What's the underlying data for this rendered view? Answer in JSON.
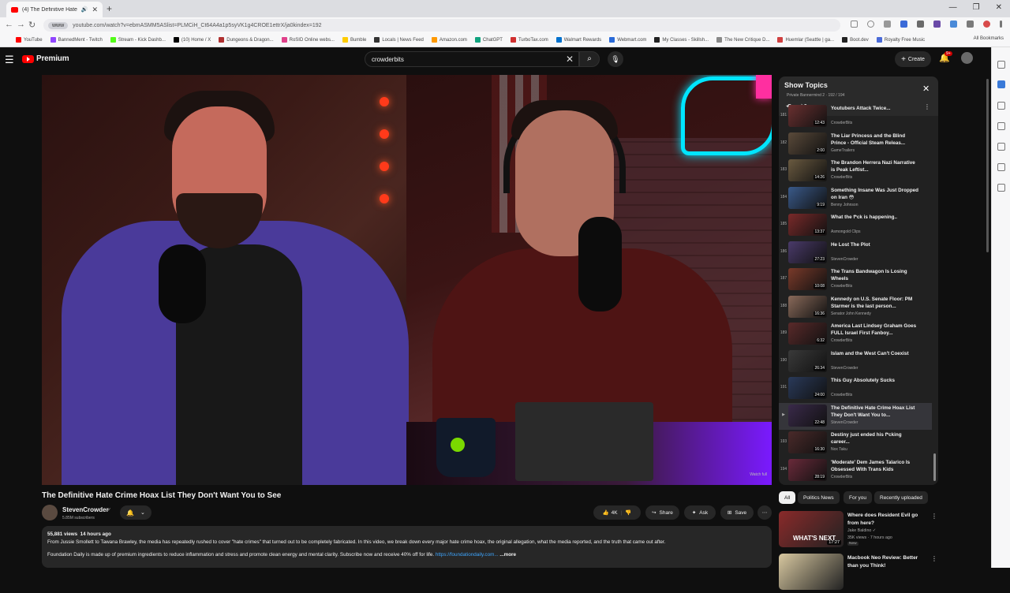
{
  "browser": {
    "tab_title": "(4) The Definitive Hate Cr",
    "url": "youtube.com/watch?v=ebmASMM5ASlist=PLMCiH_Ct64A4a1p5syVK1g4CROE1ettrX/ja0kindex=192",
    "chip_label": "www",
    "bookmarks": [
      "YouTube",
      "BannedMent - Twitch",
      "Stream - Kick Dashb...",
      "(10) Home / X",
      "Dungeons & Dragon...",
      "RoSID Online webs...",
      "Bumble",
      "Locals | News Feed",
      "Amazon.com",
      "ChatGPT",
      "TurboTax.com",
      "Walmart Rewards",
      "Webmart.com",
      "My Classes - Skillsh...",
      "The New Critique D...",
      "Huemlar (Seattle | ga...",
      "Boot.dev",
      "Royalty Free Music"
    ],
    "all_bookmarks": "All Bookmarks"
  },
  "header": {
    "logo_text": "Premium",
    "search_value": "crowderbits",
    "create_label": "Create",
    "notif_count": "9+"
  },
  "video": {
    "title": "The Definitive Hate Crime Hoax List They Don't Want You to See",
    "watermark": "Watch full"
  },
  "channel": {
    "name": "StevenCrowder",
    "subscribers": "5.85M subscribers"
  },
  "actions": {
    "likes": "4K",
    "share": "Share",
    "ask": "Ask",
    "save": "Save"
  },
  "description": {
    "views": "55,881 views",
    "age": "14 hours ago",
    "line1": "From Jussie Smollett to Tawana Brawley, the media has repeatedly rushed to cover \"hate crimes\" that turned out to be completely fabricated. In this video, we break down every major hate crime hoax, the original allegation, what the media reported, and the truth that came out after.",
    "line2": "Foundation Daily is made up of premium ingredients to reduce inflammation and stress and promote clean energy and mental clarity. Subscribe now and receive 40% off for life.",
    "link": "https://foundationdaily.com...",
    "more": "...more"
  },
  "playlist": {
    "title": "Show Topics",
    "subtitle": "Private  Bannermind 2 · 192 / 194",
    "items": [
      {
        "num": "181",
        "title": "Youtubers Attack Twice...",
        "channel": "CrowderBits",
        "dur": "12:43",
        "color": "#6a3030"
      },
      {
        "num": "182",
        "title": "The Liar Princess and the Blind Prince - Official Steam Releas...",
        "channel": "GameTrailers",
        "dur": "2:00",
        "color": "#5a4a3a"
      },
      {
        "num": "183",
        "title": "The Brandon Herrera Nazi Narrative is Peak Leftist...",
        "channel": "CrowderBits",
        "dur": "14:26",
        "color": "#6a5a40"
      },
      {
        "num": "184",
        "title": "Something Insane Was Just Dropped on Iran 😳",
        "channel": "Benny Johnson",
        "dur": "9:19",
        "color": "#3a5a8a"
      },
      {
        "num": "185",
        "title": "What the f*ck is happening..",
        "channel": "Asmongold Clips",
        "dur": "13:37",
        "color": "#7a2a2a"
      },
      {
        "num": "186",
        "title": "He Lost The Plot",
        "channel": "StevenCrowder",
        "dur": "27:23",
        "color": "#4a3a6a"
      },
      {
        "num": "187",
        "title": "The Trans Bandwagon Is Losing Wheels",
        "channel": "CrowderBits",
        "dur": "10:08",
        "color": "#7a3a2a"
      },
      {
        "num": "188",
        "title": "Kennedy on U.S. Senate Floor: PM Starmer is the last person...",
        "channel": "Senator John Kennedy",
        "dur": "16:36",
        "color": "#8a6a5a"
      },
      {
        "num": "189",
        "title": "America Last Lindsey Graham Goes FULL Israel First Fanboy...",
        "channel": "CrowderBits",
        "dur": "6:32",
        "color": "#5a2a2a"
      },
      {
        "num": "190",
        "title": "Islam and the West Can't Coexist",
        "channel": "StevenCrowder",
        "dur": "26:34",
        "color": "#3a3a3a"
      },
      {
        "num": "191",
        "title": "This Guy Absolutely Sucks",
        "channel": "CrowderBits",
        "dur": "24:00",
        "color": "#2a3a5a"
      },
      {
        "num": "▶",
        "title": "The Definitive Hate Crime Hoax List They Don't Want You to...",
        "channel": "StevenCrowder",
        "dur": "22:48",
        "color": "#3a2a4a",
        "active": true
      },
      {
        "num": "193",
        "title": "Destiny just ended his f*cking career...",
        "channel": "Nox Taku",
        "dur": "16:30",
        "color": "#4a2a2a"
      },
      {
        "num": "194",
        "title": "'Moderate' Dem James Talarico Is Obsessed With Trans Kids",
        "channel": "CrowderBits",
        "dur": "28:19",
        "color": "#6a2a3a"
      }
    ]
  },
  "chips": [
    "All",
    "Politics News",
    "For you",
    "Recently uploaded"
  ],
  "recommendations": [
    {
      "title": "Where does Resident Evil go from here?",
      "channel": "Jake Baldino ✓",
      "meta": "35K views · 7 hours ago",
      "badge": "New",
      "dur": "17:27",
      "thumb_text": "WHAT'S NEXT",
      "color": "#8a2a2a"
    },
    {
      "title": "Macbook Neo Review: Better than you Think!",
      "channel": "",
      "meta": "",
      "badge": "",
      "dur": "",
      "thumb_text": "",
      "color": "#d8c8a0"
    }
  ]
}
